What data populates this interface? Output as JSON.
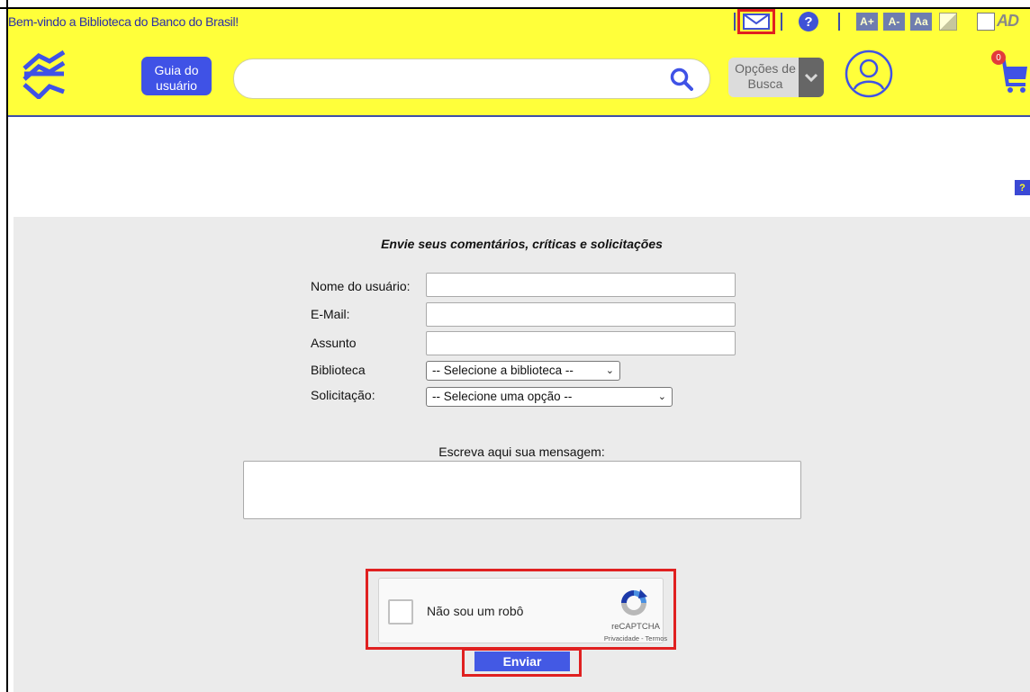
{
  "header": {
    "welcome": "Bem-vindo a Biblioteca do Banco do Brasil!",
    "guide_button": "Guia do usuário",
    "search_placeholder": "",
    "options_button": "Opções de Busca",
    "cart_count": "0",
    "font_increase": "A+",
    "font_decrease": "A-",
    "font_reset": "Aa",
    "ad_logo": "AD",
    "help_glyph": "?"
  },
  "side_help": "?",
  "form": {
    "title": "Envie seus comentários, críticas e solicitações",
    "name_label": "Nome do usuário:",
    "email_label": "E-Mail:",
    "subject_label": "Assunto",
    "library_label": "Biblioteca",
    "library_select": "-- Selecione a biblioteca --",
    "request_label": "Solicitação:",
    "request_select": "-- Selecione uma opção --",
    "message_label": "Escreva aqui sua mensagem:",
    "submit": "Enviar"
  },
  "captcha": {
    "label": "Não sou um robô",
    "brand": "reCAPTCHA",
    "links": "Privacidade - Termos"
  },
  "colors": {
    "header_bg": "#ffff3a",
    "accent_blue": "#3f52e6",
    "highlight_red": "#e02020",
    "form_bg": "#ebebeb"
  }
}
